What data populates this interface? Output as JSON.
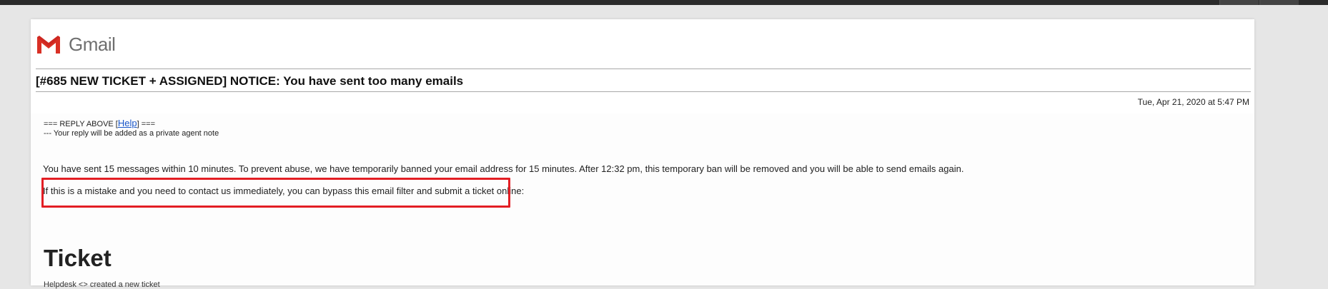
{
  "app": {
    "logo_text": "Gmail"
  },
  "email": {
    "subject": "[#685 NEW TICKET + ASSIGNED] NOTICE: You have sent too many emails",
    "date": "Tue, Apr 21, 2020 at 5:47 PM",
    "reply_line_prefix": "===   REPLY ABOVE [",
    "reply_help_link": "Help",
    "reply_line_suffix": "] ===",
    "private_note": "--- Your reply will be added as a private agent note",
    "paragraph1": "You have sent 15 messages within 10 minutes. To prevent abuse, we have temporarily banned your email address for 15 minutes. After 12:32 pm, this temporary ban will be removed and you will be able to send emails again.",
    "paragraph2": "If this is a mistake and you need to contact us immediately, you can bypass this email filter and submit a ticket online:",
    "ticket_heading": "Ticket",
    "ticket_sub": "Helpdesk <> created a new ticket"
  },
  "colors": {
    "highlight": "#e31e24",
    "link": "#1a57c9",
    "gmail_red": "#d93025"
  }
}
